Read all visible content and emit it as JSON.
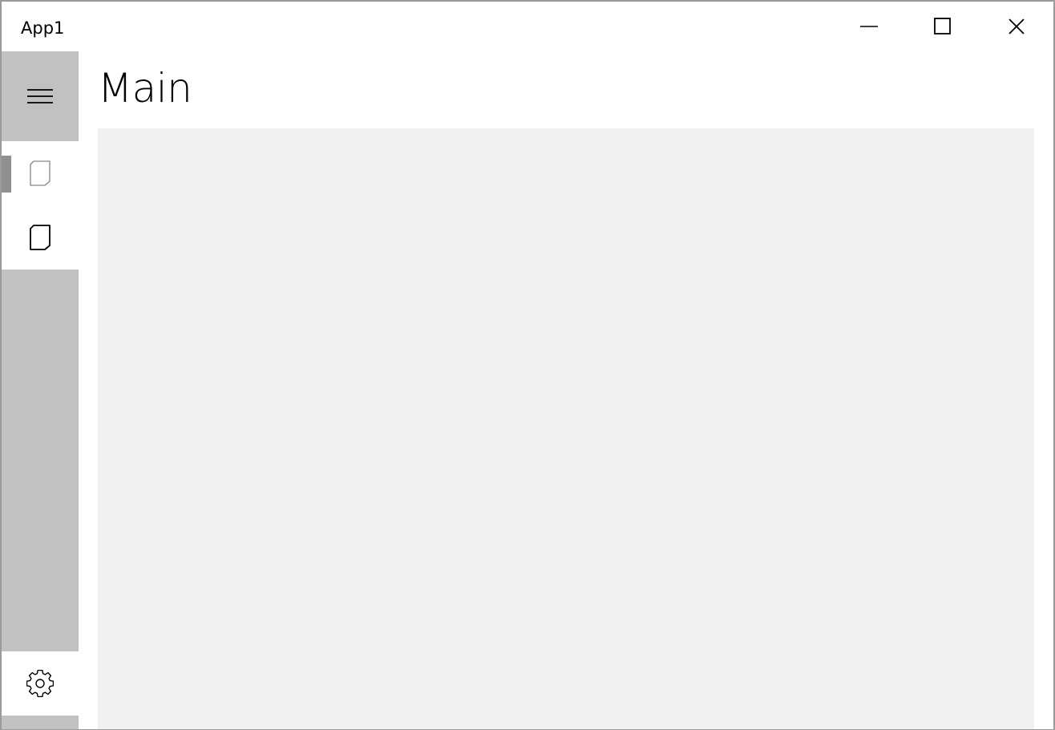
{
  "window": {
    "title": "App1",
    "controls": {
      "minimize_icon": "minimize-icon",
      "maximize_icon": "maximize-icon",
      "close_icon": "close-icon"
    }
  },
  "navigation": {
    "menu_icon": "hamburger-icon",
    "items": [
      {
        "icon": "page-icon",
        "selected": true
      },
      {
        "icon": "page-icon",
        "selected": false
      }
    ],
    "settings_icon": "gear-icon"
  },
  "main": {
    "page_title": "Main"
  },
  "colors": {
    "pane_background": "#c1c1c1",
    "selection_indicator": "#8f8f8f",
    "content_background": "#f1f1f1",
    "window_border": "#9a9a9a"
  }
}
